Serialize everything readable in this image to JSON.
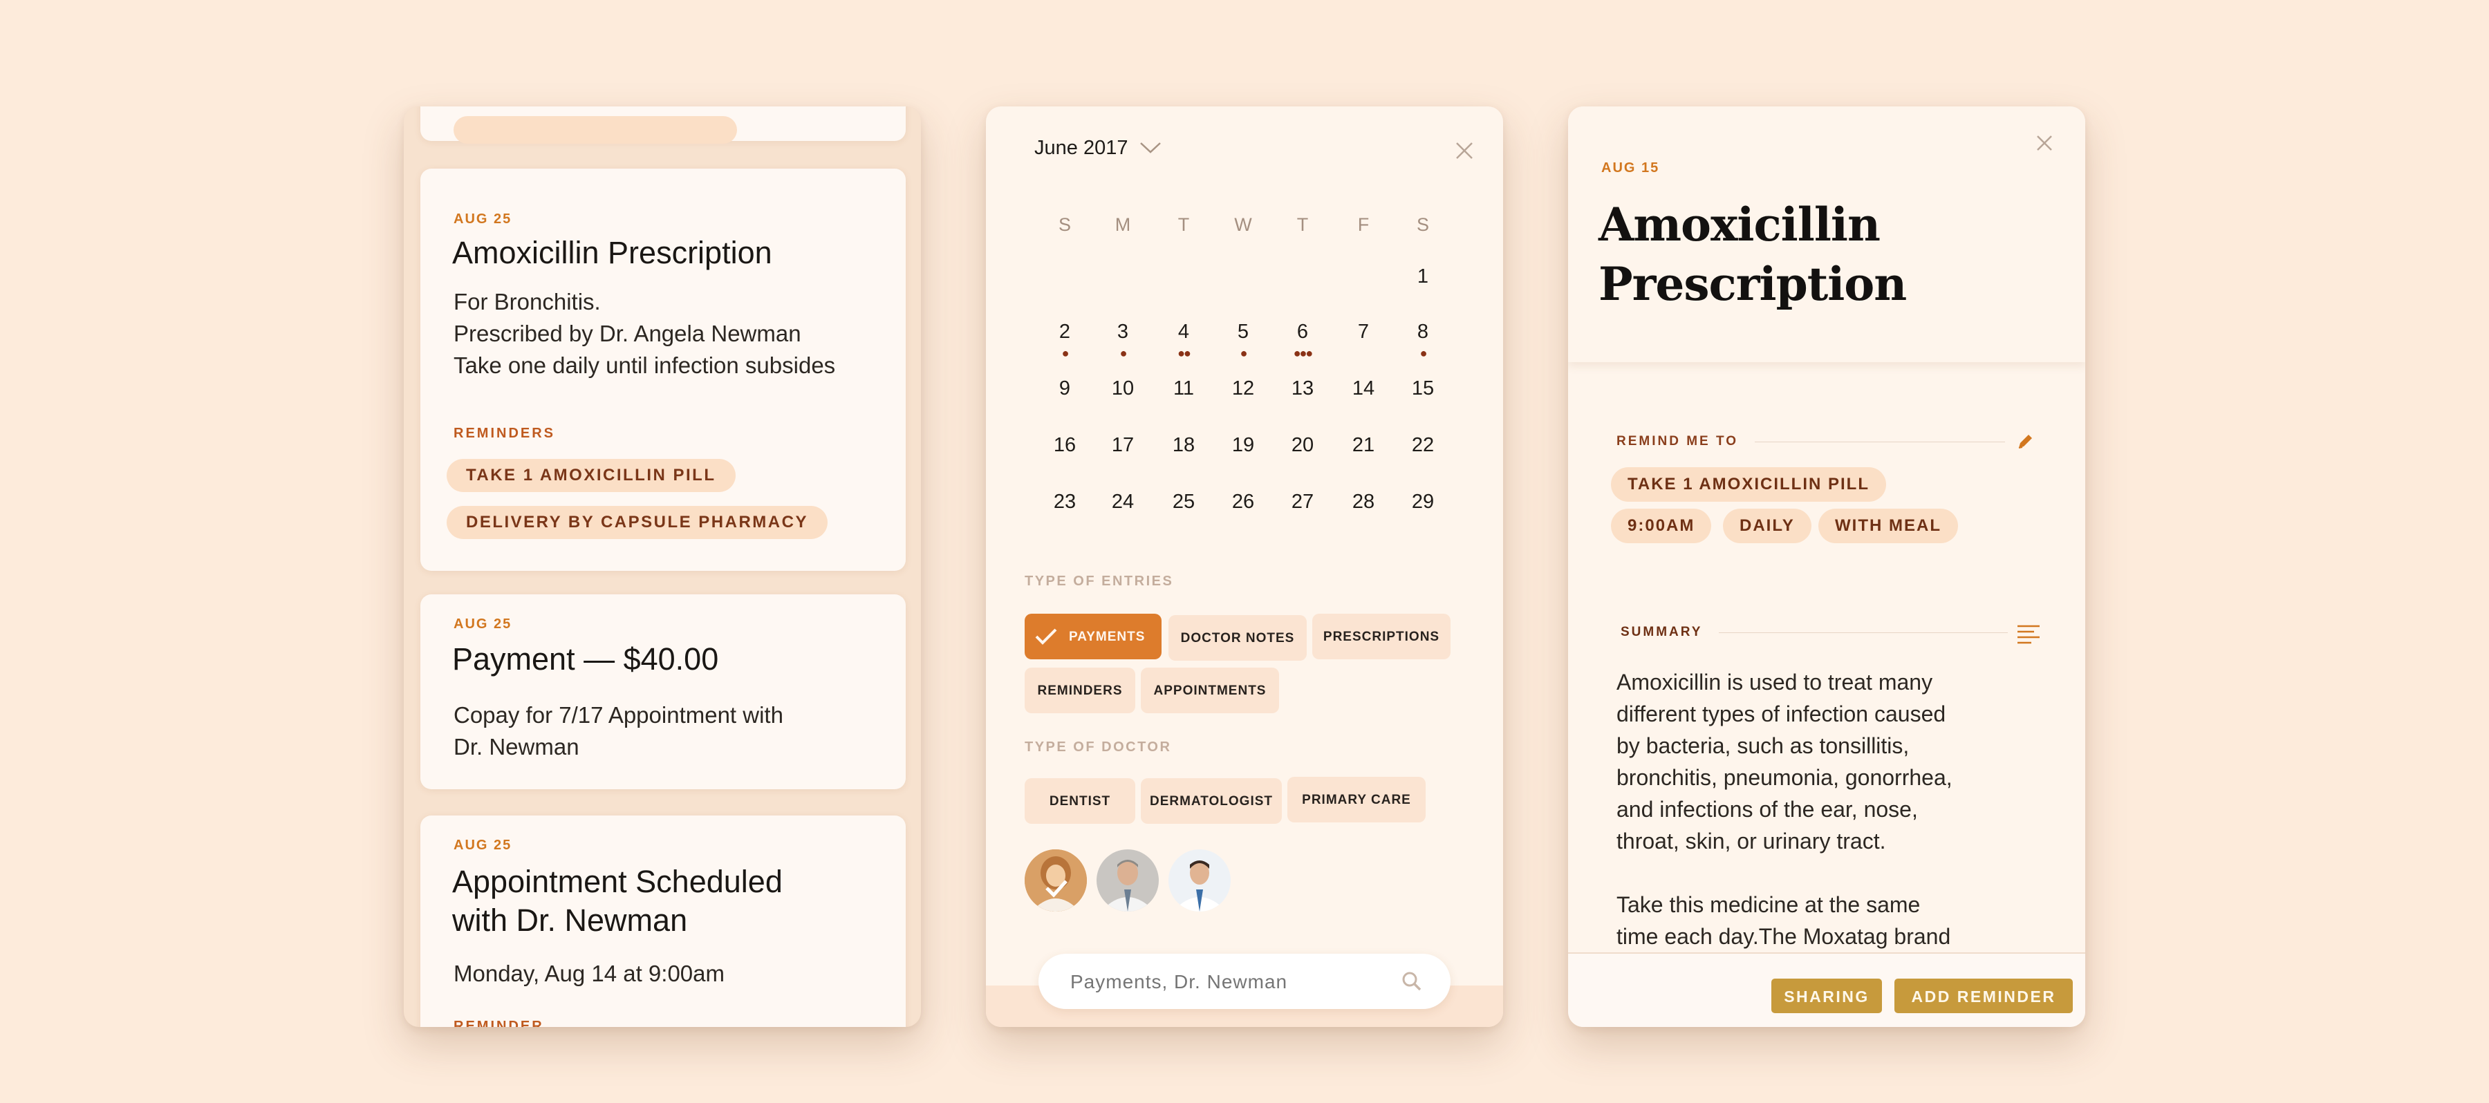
{
  "timeline": {
    "cards": [
      {
        "date": "AUG 25",
        "title": "Amoxicillin Prescription",
        "body": [
          "For Bronchitis.",
          "Prescribed by Dr. Angela Newman",
          "Take one daily until infection subsides"
        ],
        "reminders_label": "REMINDERS",
        "reminders": [
          "TAKE 1 AMOXICILLIN PILL",
          "DELIVERY BY CAPSULE PHARMACY"
        ]
      },
      {
        "date": "AUG 25",
        "title": "Payment — $40.00",
        "body": [
          "Copay for 7/17 Appointment with",
          "Dr. Newman"
        ]
      },
      {
        "date": "AUG 25",
        "title": [
          "Appointment Scheduled",
          "with Dr. Newman"
        ],
        "body": [
          "Monday, Aug 14 at 9:00am"
        ],
        "reminder_label": "REMINDER"
      }
    ]
  },
  "calendar": {
    "month": "June 2017",
    "weekdays": [
      "S",
      "M",
      "T",
      "W",
      "T",
      "F",
      "S"
    ],
    "weeks": [
      [
        "",
        "",
        "",
        "",
        "",
        "",
        "1"
      ],
      [
        "2",
        "3",
        "4",
        "5",
        "6",
        "7",
        "8"
      ],
      [
        "9",
        "10",
        "11",
        "12",
        "13",
        "14",
        "15"
      ],
      [
        "16",
        "17",
        "18",
        "19",
        "20",
        "21",
        "22"
      ],
      [
        "23",
        "24",
        "25",
        "26",
        "27",
        "28",
        "29"
      ]
    ],
    "entry_dots": {
      "2": 1,
      "3": 1,
      "4": 2,
      "5": 1,
      "6": 3,
      "8": 1
    },
    "type_of_entries_label": "TYPE OF ENTRIES",
    "entries": [
      {
        "label": "PAYMENTS",
        "selected": true
      },
      {
        "label": "DOCTOR NOTES",
        "selected": false
      },
      {
        "label": "PRESCRIPTIONS",
        "selected": false
      },
      {
        "label": "REMINDERS",
        "selected": false
      },
      {
        "label": "APPOINTMENTS",
        "selected": false
      }
    ],
    "type_of_doctor_label": "TYPE OF DOCTOR",
    "doctors": [
      "DENTIST",
      "DERMATOLOGIST",
      "PRIMARY CARE"
    ],
    "search_placeholder": "Payments, Dr. Newman"
  },
  "detail": {
    "date": "AUG 15",
    "title": [
      "Amoxicillin",
      "Prescription"
    ],
    "remind_label": "REMIND ME TO",
    "remind_pills": [
      "TAKE 1 AMOXICILLIN PILL",
      "9:00AM",
      "DAILY",
      "WITH MEAL"
    ],
    "summary_label": "SUMMARY",
    "summary": [
      "Amoxicillin is used to treat many",
      "different types of infection caused",
      "by bacteria, such as tonsillitis,",
      "bronchitis, pneumonia, gonorrhea,",
      "and infections of the ear, nose,",
      "throat, skin, or urinary tract.",
      "",
      "Take this medicine at the same",
      "time each day.The Moxatag brand"
    ],
    "sharing_label": "SHARING",
    "add_reminder_label": "ADD REMINDER"
  },
  "colors": {
    "background": "#fdebdb",
    "accent_orange": "#dd7c2c",
    "pill_bg": "#fbdfc6",
    "dot": "#8a3216",
    "button_gold": "#c79a3c"
  }
}
